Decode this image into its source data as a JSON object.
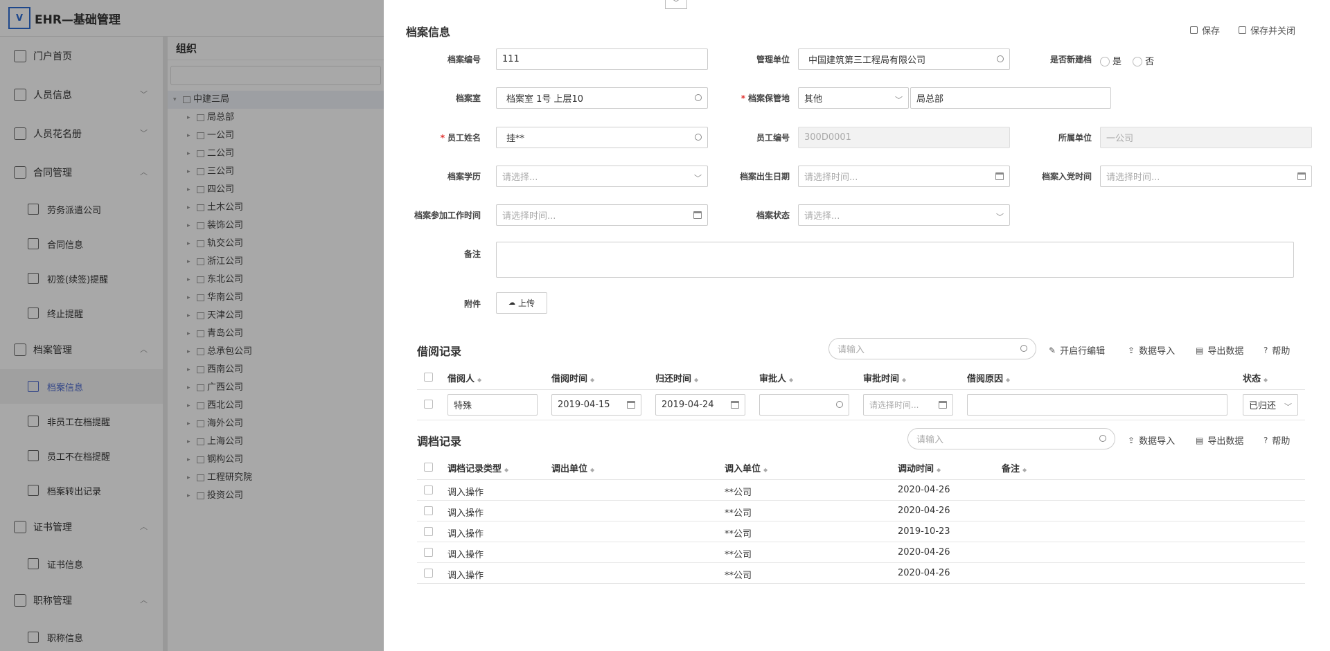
{
  "app": {
    "title": "EHR—基础管理"
  },
  "sidebar": {
    "items": [
      {
        "label": "门户首页",
        "icon": "hub-icon",
        "kind": "nav"
      },
      {
        "label": "人员信息",
        "icon": "person-card-icon",
        "kind": "nav",
        "chev": "﹀"
      },
      {
        "label": "人员花名册",
        "icon": "person-icon",
        "kind": "nav",
        "chev": "﹀"
      },
      {
        "label": "合同管理",
        "icon": "contract-icon",
        "kind": "nav",
        "chev": "︿"
      },
      {
        "label": "劳务派遣公司",
        "icon": "company-doc-icon",
        "kind": "sub"
      },
      {
        "label": "合同信息",
        "icon": "contract-info-icon",
        "kind": "sub"
      },
      {
        "label": "初签(续签)提醒",
        "icon": "hand-icon",
        "kind": "sub"
      },
      {
        "label": "终止提醒",
        "icon": "chart-icon",
        "kind": "sub"
      },
      {
        "label": "档案管理",
        "icon": "archive-icon",
        "kind": "nav",
        "chev": "︿"
      },
      {
        "label": "档案信息",
        "icon": "archive-info-icon",
        "kind": "sub",
        "active": true
      },
      {
        "label": "非员工在档提醒",
        "icon": "doc-icon",
        "kind": "sub"
      },
      {
        "label": "员工不在档提醒",
        "icon": "doc-icon",
        "kind": "sub"
      },
      {
        "label": "档案转出记录",
        "icon": "list-doc-icon",
        "kind": "sub"
      },
      {
        "label": "证书管理",
        "icon": "certificate-icon",
        "kind": "nav",
        "chev": "︿"
      },
      {
        "label": "证书信息",
        "icon": "certificate-info-icon",
        "kind": "sub"
      },
      {
        "label": "职称管理",
        "icon": "title-icon",
        "kind": "nav",
        "chev": "︿"
      },
      {
        "label": "职称信息",
        "icon": "title-info-icon",
        "kind": "sub"
      }
    ]
  },
  "org": {
    "title": "组织",
    "root": "中建三局",
    "children": [
      "局总部",
      "一公司",
      "二公司",
      "三公司",
      "四公司",
      "土木公司",
      "装饰公司",
      "轨交公司",
      "浙江公司",
      "东北公司",
      "华南公司",
      "天津公司",
      "青岛公司",
      "总承包公司",
      "西南公司",
      "广西公司",
      "西北公司",
      "海外公司",
      "上海公司",
      "钢构公司",
      "工程研究院",
      "投资公司"
    ]
  },
  "form": {
    "title": "档案信息",
    "save": "保存",
    "save_close": "保存并关闭",
    "labels": {
      "archive_no": "档案编号",
      "mgmt_unit": "管理单位",
      "is_new": "是否新建档",
      "archive_room": "档案室",
      "archive_place": "档案保管地",
      "emp_name": "员工姓名",
      "emp_no": "员工编号",
      "unit": "所属单位",
      "education": "档案学历",
      "birth": "档案出生日期",
      "party_date": "档案入党时间",
      "work_date": "档案参加工作时间",
      "status": "档案状态",
      "remark": "备注",
      "attachment": "附件"
    },
    "values": {
      "archive_no": "111",
      "mgmt_unit": "中国建筑第三工程局有限公司",
      "radio_yes": "是",
      "radio_no": "否",
      "archive_room": "档案室 1号 上层10",
      "archive_place_select": "其他",
      "archive_place_text": "局总部",
      "emp_name": "挂**",
      "emp_no": "300D0001",
      "unit": "一公司",
      "upload": "上传"
    },
    "placeholders": {
      "select": "请选择...",
      "time": "请选择时间..."
    }
  },
  "borrow": {
    "title": "借阅记录",
    "search_placeholder": "请输入",
    "actions": {
      "edit": "开启行编辑",
      "import": "数据导入",
      "export": "导出数据",
      "help": "帮助"
    },
    "columns": [
      "借阅人",
      "借阅时间",
      "归还时间",
      "审批人",
      "审批时间",
      "借阅原因",
      "状态"
    ],
    "row": {
      "person": "特殊",
      "borrow_date": "2019-04-15",
      "return_date": "2019-04-24",
      "approve_time_ph": "请选择时间...",
      "status": "已归还"
    }
  },
  "transfer": {
    "title": "调档记录",
    "search_placeholder": "请输入",
    "actions": {
      "import": "数据导入",
      "export": "导出数据",
      "help": "帮助"
    },
    "columns": [
      "调档记录类型",
      "调出单位",
      "调入单位",
      "调动时间",
      "备注"
    ],
    "rows": [
      {
        "type": "调入操作",
        "out": "",
        "in": "**公司",
        "date": "2020-04-26",
        "note": ""
      },
      {
        "type": "调入操作",
        "out": "",
        "in": "**公司",
        "date": "2020-04-26",
        "note": ""
      },
      {
        "type": "调入操作",
        "out": "",
        "in": "**公司",
        "date": "2019-10-23",
        "note": ""
      },
      {
        "type": "调入操作",
        "out": "",
        "in": "**公司",
        "date": "2020-04-26",
        "note": ""
      },
      {
        "type": "调入操作",
        "out": "",
        "in": "**公司",
        "date": "2020-04-26",
        "note": ""
      }
    ]
  }
}
